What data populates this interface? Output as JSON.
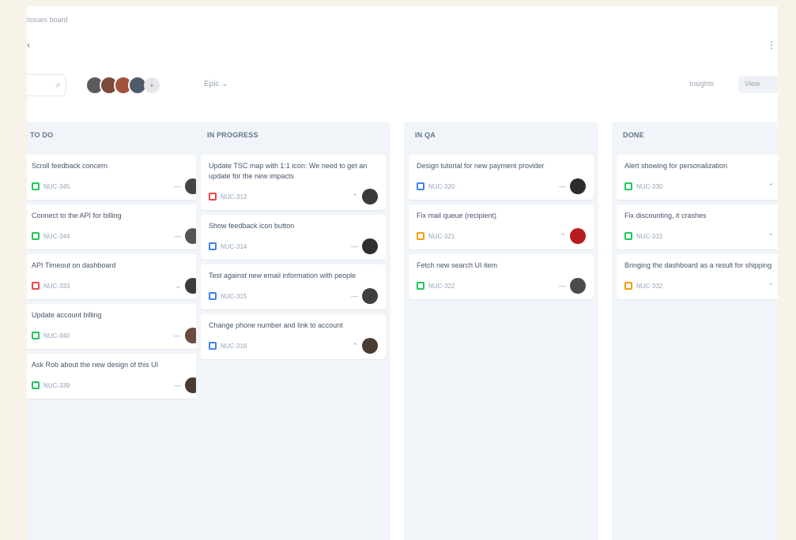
{
  "colors": {
    "page_bg": "#f8f3e8",
    "board_bg": "#ffffff",
    "column_bg": "#f1f5f9",
    "story": "#22c55e",
    "bug": "#ef4444",
    "task": "#3b82f6",
    "epic": "#f59e0b"
  },
  "header": {
    "breadcrumb": "Issues board",
    "back_icon": "chevron-left-icon",
    "more_icon": "more-vertical-icon"
  },
  "toolbar": {
    "search_placeholder": "",
    "search_icon": "search-icon",
    "avatars": [
      "#5b5b5b",
      "#7b4a3a",
      "#a0523c",
      "#4d5a6a"
    ],
    "avatars_more": "+",
    "filter_label": "Epic ⌄",
    "right_label_1": "Insights",
    "right_label_2": "View"
  },
  "columns": [
    {
      "header": "TO DO",
      "cards": [
        {
          "title": "Scroll feedback concern",
          "key": "NUC-345",
          "type_color": "#22c55e",
          "prio": "—",
          "avatar": "#444"
        },
        {
          "title": "Connect to the API for billing",
          "key": "NUC-344",
          "type_color": "#22c55e",
          "prio": "—",
          "avatar": "#555"
        },
        {
          "title": "API Timeout on dashboard",
          "key": "NUC-333",
          "type_color": "#ef4444",
          "prio": "⌄",
          "avatar": "#3a3a3a"
        },
        {
          "title": "Update account billing",
          "key": "NUC-340",
          "type_color": "#22c55e",
          "prio": "—",
          "avatar": "#6a4b3d"
        },
        {
          "title": "Ask Rob about the new design of this UI",
          "key": "NUC-339",
          "type_color": "#22c55e",
          "prio": "—",
          "avatar": "#4b3a2f"
        }
      ]
    },
    {
      "header": "IN PROGRESS",
      "cards": [
        {
          "title": "Update TSC map with 1:1 icon: We need to get an update for the new impacts",
          "key": "NUC-312",
          "type_color": "#ef4444",
          "prio": "⌃",
          "avatar": "#3a3a3a"
        },
        {
          "title": "Show feedback icon button",
          "key": "NUC-314",
          "type_color": "#3b82f6",
          "prio": "—",
          "avatar": "#2f2f2f"
        },
        {
          "title": "Test against new email information with people",
          "key": "NUC-315",
          "type_color": "#3b82f6",
          "prio": "—",
          "avatar": "#404040"
        },
        {
          "title": "Change phone number and link to account",
          "key": "NUC-316",
          "type_color": "#3b82f6",
          "prio": "⌃",
          "avatar": "#4a3c33"
        }
      ]
    },
    {
      "header": "IN QA",
      "cards": [
        {
          "title": "Design tutorial for new payment provider",
          "key": "NUC-320",
          "type_color": "#3b82f6",
          "prio": "—",
          "avatar": "#2c2c2c"
        },
        {
          "title": "Fix mail queue (recipient)",
          "key": "NUC-321",
          "type_color": "#f59e0b",
          "prio": "⌃",
          "avatar": "#b91c1c"
        },
        {
          "title": "Fetch new search UI item",
          "key": "NUC-322",
          "type_color": "#22c55e",
          "prio": "—",
          "avatar": "#4b4b4b"
        }
      ]
    },
    {
      "header": "DONE",
      "cards": [
        {
          "title": "Alert showing for personalization",
          "key": "NUC-330",
          "type_color": "#22c55e",
          "prio": "⌃",
          "avatar": "#555"
        },
        {
          "title": "Fix discounting, it crashes",
          "key": "NUC-331",
          "type_color": "#22c55e",
          "prio": "⌃",
          "avatar": "#666"
        },
        {
          "title": "Bringing the dashboard as a result for shipping",
          "key": "NUC-332",
          "type_color": "#f59e0b",
          "prio": "⌃",
          "avatar": "#777"
        }
      ]
    }
  ]
}
